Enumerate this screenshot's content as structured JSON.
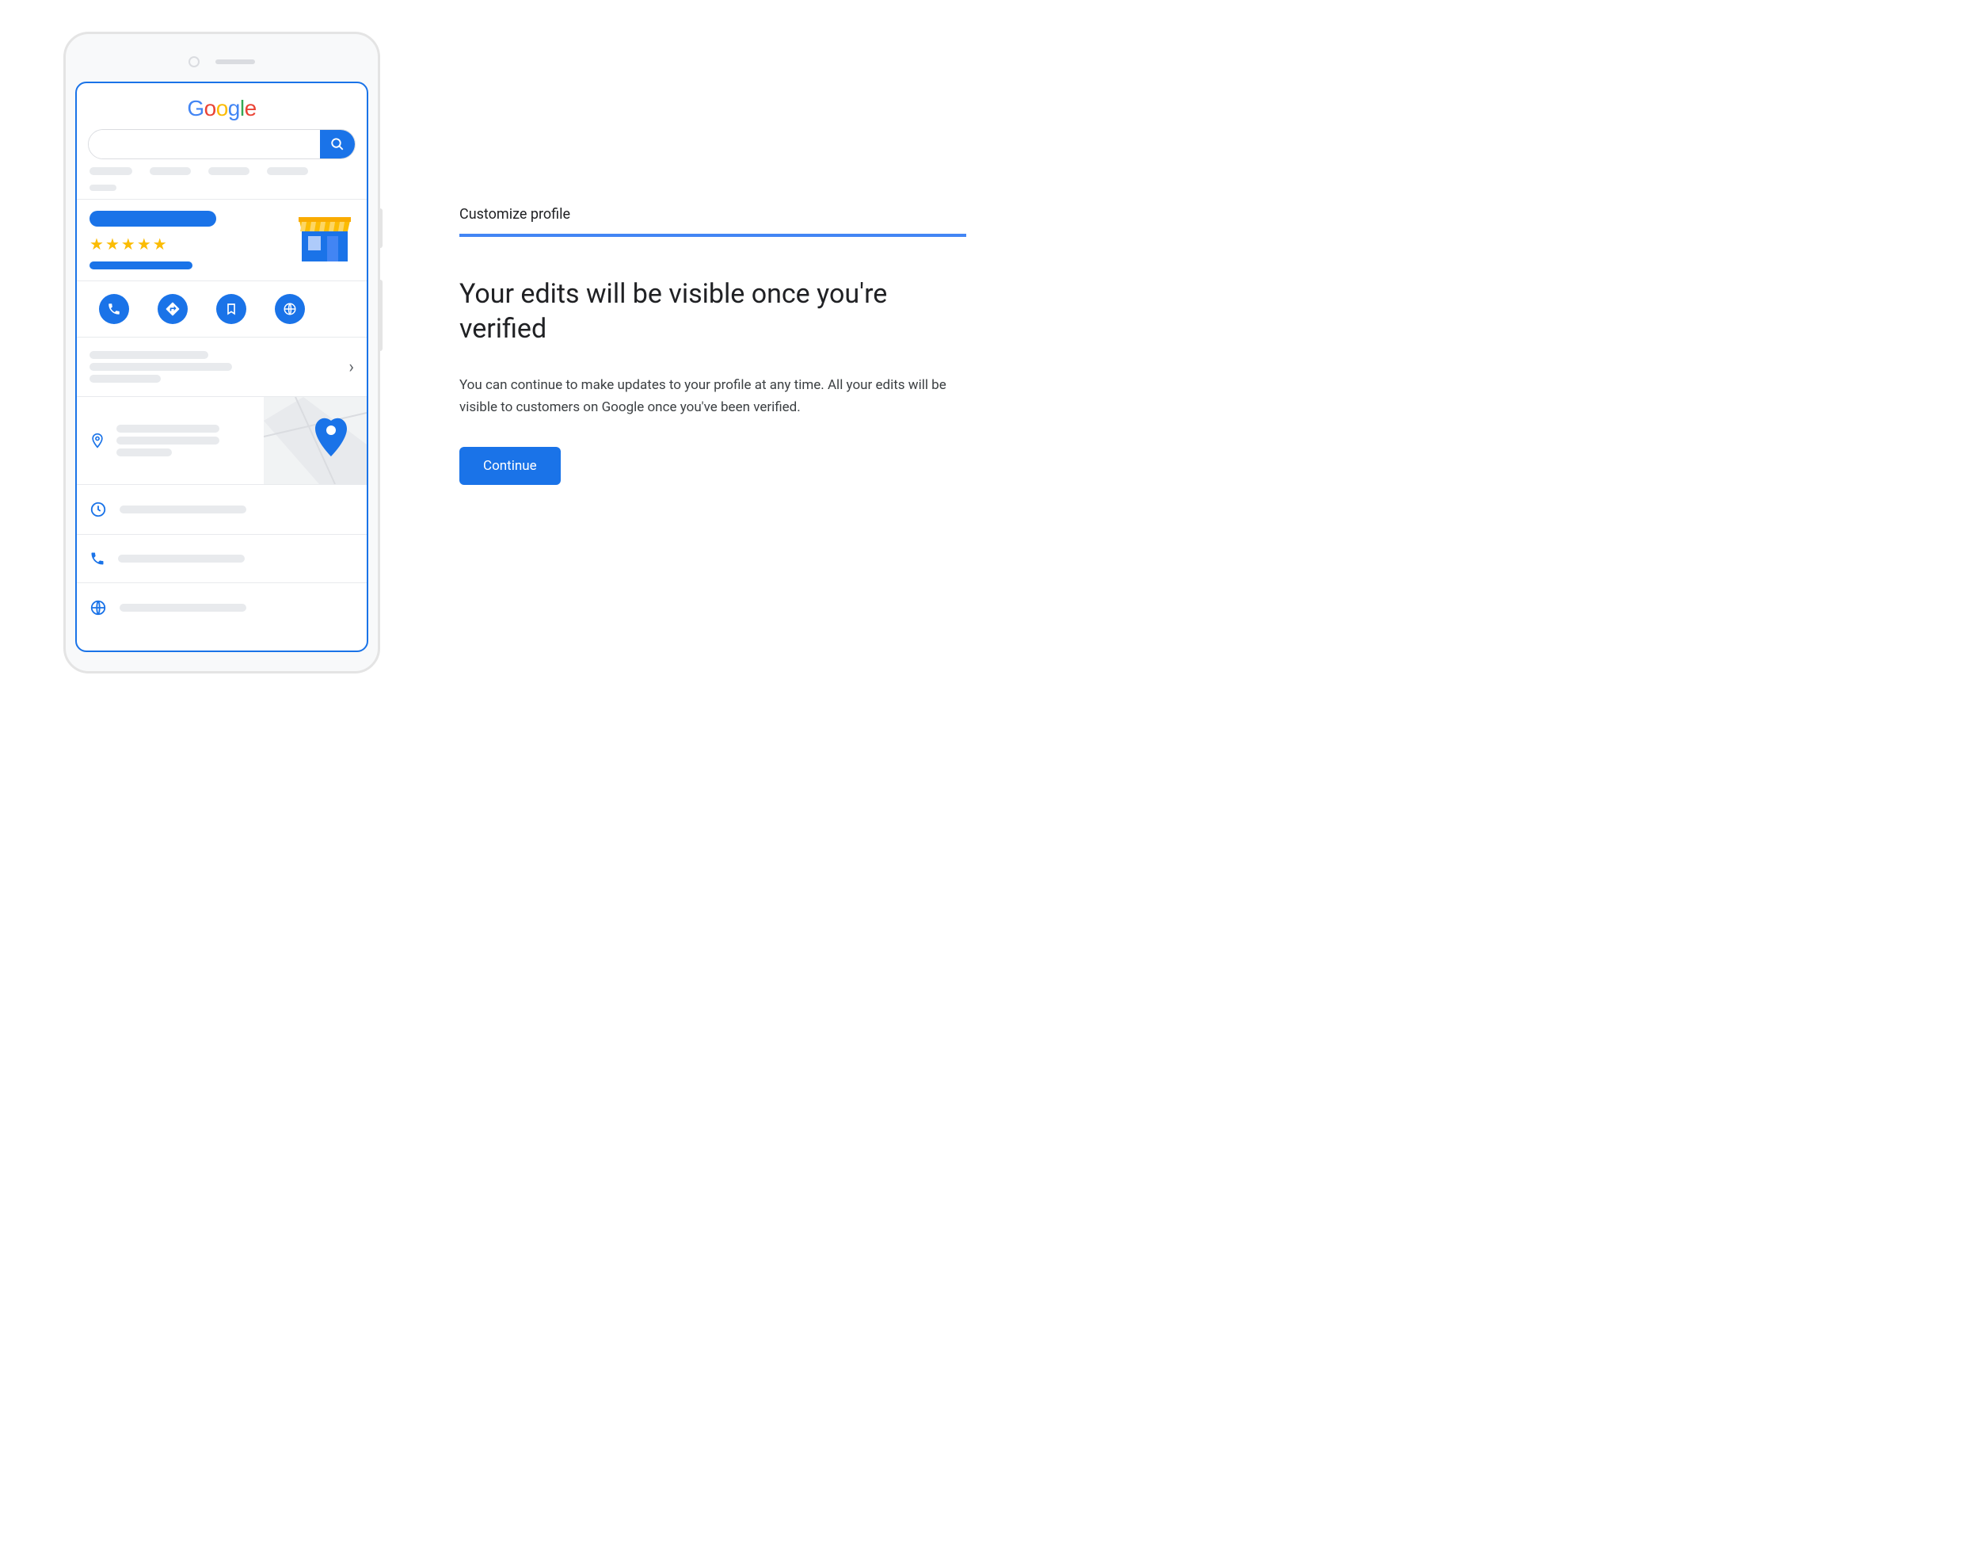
{
  "phone": {
    "logo_letters": [
      "G",
      "o",
      "o",
      "g",
      "l",
      "e"
    ],
    "search_placeholder": "",
    "star_count": 5,
    "action_icons": [
      "phone-icon",
      "directions-icon",
      "bookmark-icon",
      "website-icon"
    ],
    "rows": {
      "location_icon": "location-pin-icon",
      "hours_icon": "clock-icon",
      "phone_icon": "phone-outline-icon",
      "website_icon": "globe-icon"
    }
  },
  "panel": {
    "section_label": "Customize profile",
    "headline": "Your edits will be visible once you're verified",
    "description": "You can continue to make updates to your profile at any time. All your edits will be visible to customers on Google once you've been verified.",
    "continue_label": "Continue"
  },
  "colors": {
    "primary": "#1a73e8",
    "star": "#fbbc04"
  }
}
